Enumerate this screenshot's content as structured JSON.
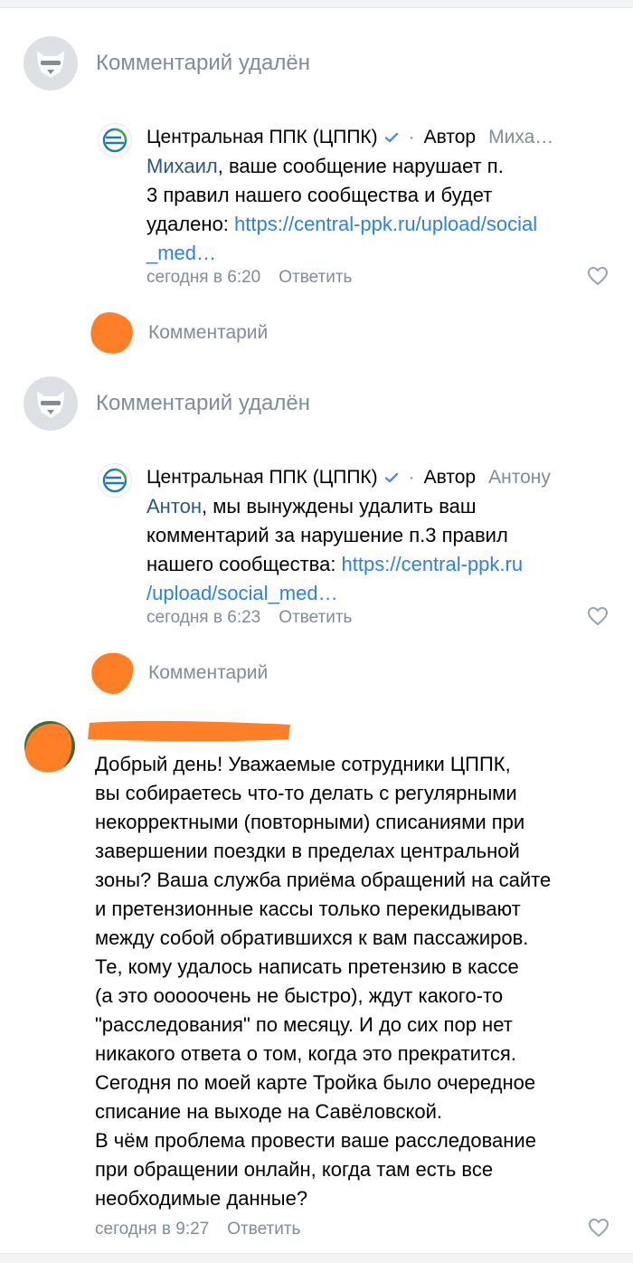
{
  "colors": {
    "accent_link": "#2d81e0",
    "mention": "#2a5885",
    "secondary_text": "#818c99",
    "redaction": "#ff7f27",
    "verified": "#4a90d9"
  },
  "icons": {
    "deleted_avatar": "ghost-dog-icon",
    "brand_avatar": "cppk-logo-icon",
    "verified": "verified-check-icon",
    "like": "heart-icon"
  },
  "thread": [
    {
      "deleted": {
        "text": "Комментарий удалён"
      },
      "reply": {
        "author_name": "Центральная ППК (ЦППК)",
        "author_badge": "Автор",
        "reply_to": "Миха…",
        "mention": "Михаил",
        "lines": [
          ", ваше сообщение нарушает п.",
          "3 правил нашего сообщества и будет",
          "удалено: ",
          "_med…"
        ],
        "link_part1": "https://central-ppk.ru/upload/social",
        "time": "сегодня в 6:20",
        "reply_label": "Ответить"
      },
      "comment_prompt": "Комментарий"
    },
    {
      "deleted": {
        "text": "Комментарий удалён"
      },
      "reply": {
        "author_name": "Центральная ППК (ЦППК)",
        "author_badge": "Автор",
        "reply_to": "Антону",
        "mention": "Антон",
        "lines": [
          ", мы вынуждены удалить ваш",
          "комментарий за нарушение п.3 правил",
          "нашего сообщества: ",
          "/upload/social_med…"
        ],
        "link_part1": "https://central-ppk.ru",
        "time": "сегодня в 6:23",
        "reply_label": "Ответить"
      },
      "comment_prompt": "Комментарий"
    }
  ],
  "main_comment": {
    "lines": [
      "Добрый день! Уважаемые сотрудники ЦППК,",
      "вы собираетесь что-то делать с регулярными",
      "некорректными (повторными) списаниями при",
      "завершении поездки в пределах центральной",
      "зоны? Ваша служба приёма обращений на сайте",
      "и претензионные кассы только перекидывают",
      "между собой обратившихся к вам пассажиров.",
      "Те, кому удалось написать претензию в кассе",
      "(а это ооооочень не быстро), ждут какого-то",
      "\"расследования\" по месяцу. И до сих пор нет",
      "никакого ответа о том, когда это прекратится.",
      "Сегодня по моей карте Тройка было очередное",
      "списание на выходе на Савёловской.",
      "В чём проблема провести ваше расследование",
      "при обращении онлайн, когда там есть все",
      "необходимые данные?"
    ],
    "time": "сегодня в 9:27",
    "reply_label": "Ответить"
  }
}
